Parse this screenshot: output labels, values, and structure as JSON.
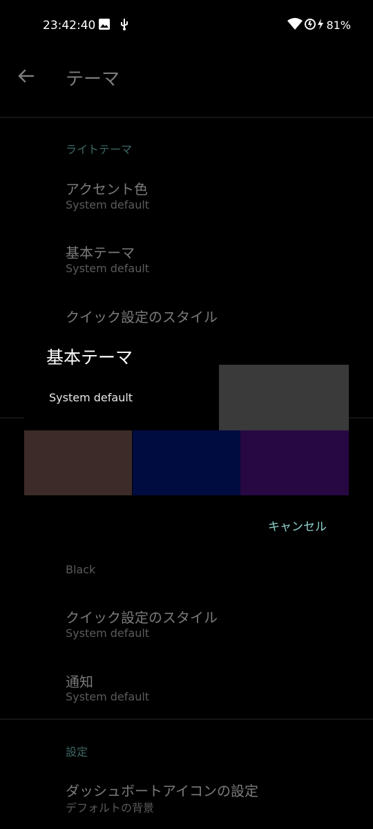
{
  "status_bar": {
    "time": "23:42:40",
    "battery": "81%"
  },
  "app_bar": {
    "title": "テーマ"
  },
  "light_theme": {
    "header": "ライトテーマ",
    "items": [
      {
        "title": "アクセント色",
        "subtitle": "System default"
      },
      {
        "title": "基本テーマ",
        "subtitle": "System default"
      },
      {
        "title": "クイック設定のスタイル"
      }
    ]
  },
  "dark_theme_partial": {
    "items": [
      {
        "subtitle": "Black"
      },
      {
        "title": "クイック設定のスタイル",
        "subtitle": "System default"
      },
      {
        "title": "通知",
        "subtitle": "System default"
      }
    ]
  },
  "settings": {
    "header": "設定",
    "items": [
      {
        "title": "ダッシュボートアイコンの設定",
        "subtitle": "デフォルトの背景"
      }
    ]
  },
  "dialog": {
    "title": "基本テーマ",
    "option_system": "System default",
    "cancel": "キャンセル",
    "swatches": [
      {
        "color": "#3a3a3a"
      },
      {
        "color": "#3c2b28"
      },
      {
        "color": "#000c40"
      },
      {
        "color": "#270842"
      }
    ]
  }
}
